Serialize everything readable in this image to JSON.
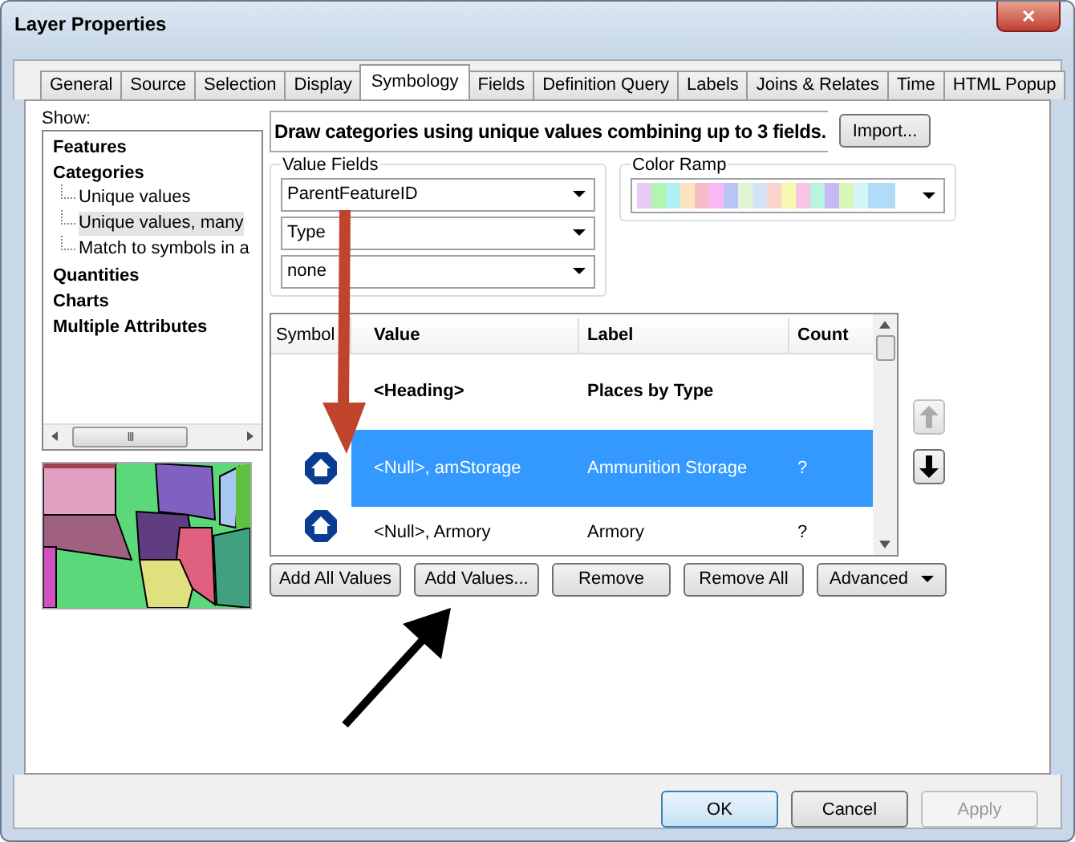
{
  "window": {
    "title": "Layer Properties",
    "close": "✕"
  },
  "tabs": [
    {
      "label": "General",
      "selected": false
    },
    {
      "label": "Source",
      "selected": false
    },
    {
      "label": "Selection",
      "selected": false
    },
    {
      "label": "Display",
      "selected": false
    },
    {
      "label": "Symbology",
      "selected": true
    },
    {
      "label": "Fields",
      "selected": false
    },
    {
      "label": "Definition Query",
      "selected": false
    },
    {
      "label": "Labels",
      "selected": false
    },
    {
      "label": "Joins & Relates",
      "selected": false
    },
    {
      "label": "Time",
      "selected": false
    },
    {
      "label": "HTML Popup",
      "selected": false
    }
  ],
  "show": {
    "label": "Show:",
    "items": [
      {
        "label": "Features",
        "selected": false
      },
      {
        "label": "Categories",
        "selected": false,
        "children": [
          {
            "label": "Unique values",
            "selected": false
          },
          {
            "label": "Unique values, many",
            "selected": true
          },
          {
            "label": "Match to symbols in a",
            "selected": false
          }
        ]
      },
      {
        "label": "Quantities",
        "selected": false
      },
      {
        "label": "Charts",
        "selected": false
      },
      {
        "label": "Multiple Attributes",
        "selected": false
      }
    ],
    "scroll_thumb": "III"
  },
  "description": "Draw categories using unique values combining up to 3 fields.",
  "import_button": "Import...",
  "value_fields": {
    "label": "Value Fields",
    "fields": [
      "ParentFeatureID",
      "Type",
      "none"
    ]
  },
  "color_ramp": {
    "label": "Color Ramp"
  },
  "table": {
    "columns": [
      "Symbol",
      "Value",
      "Label",
      "Count"
    ],
    "rows": [
      {
        "kind": "heading",
        "value": "<Heading>",
        "label": "Places by Type",
        "selected": false
      },
      {
        "kind": "item",
        "value": "<Null>, amStorage",
        "label": "Ammunition Storage",
        "count": "?",
        "selected": true
      },
      {
        "kind": "item",
        "value": "<Null>, Armory",
        "label": "Armory",
        "count": "?",
        "selected": false
      }
    ]
  },
  "move_up": {
    "disabled": true
  },
  "move_down": {
    "disabled": false
  },
  "buttons": [
    "Add All Values",
    "Add Values...",
    "Remove",
    "Remove All",
    "Advanced"
  ],
  "dialog_buttons": [
    {
      "label": "OK",
      "disabled": false
    },
    {
      "label": "Cancel",
      "disabled": false
    },
    {
      "label": "Apply",
      "disabled": true
    }
  ]
}
